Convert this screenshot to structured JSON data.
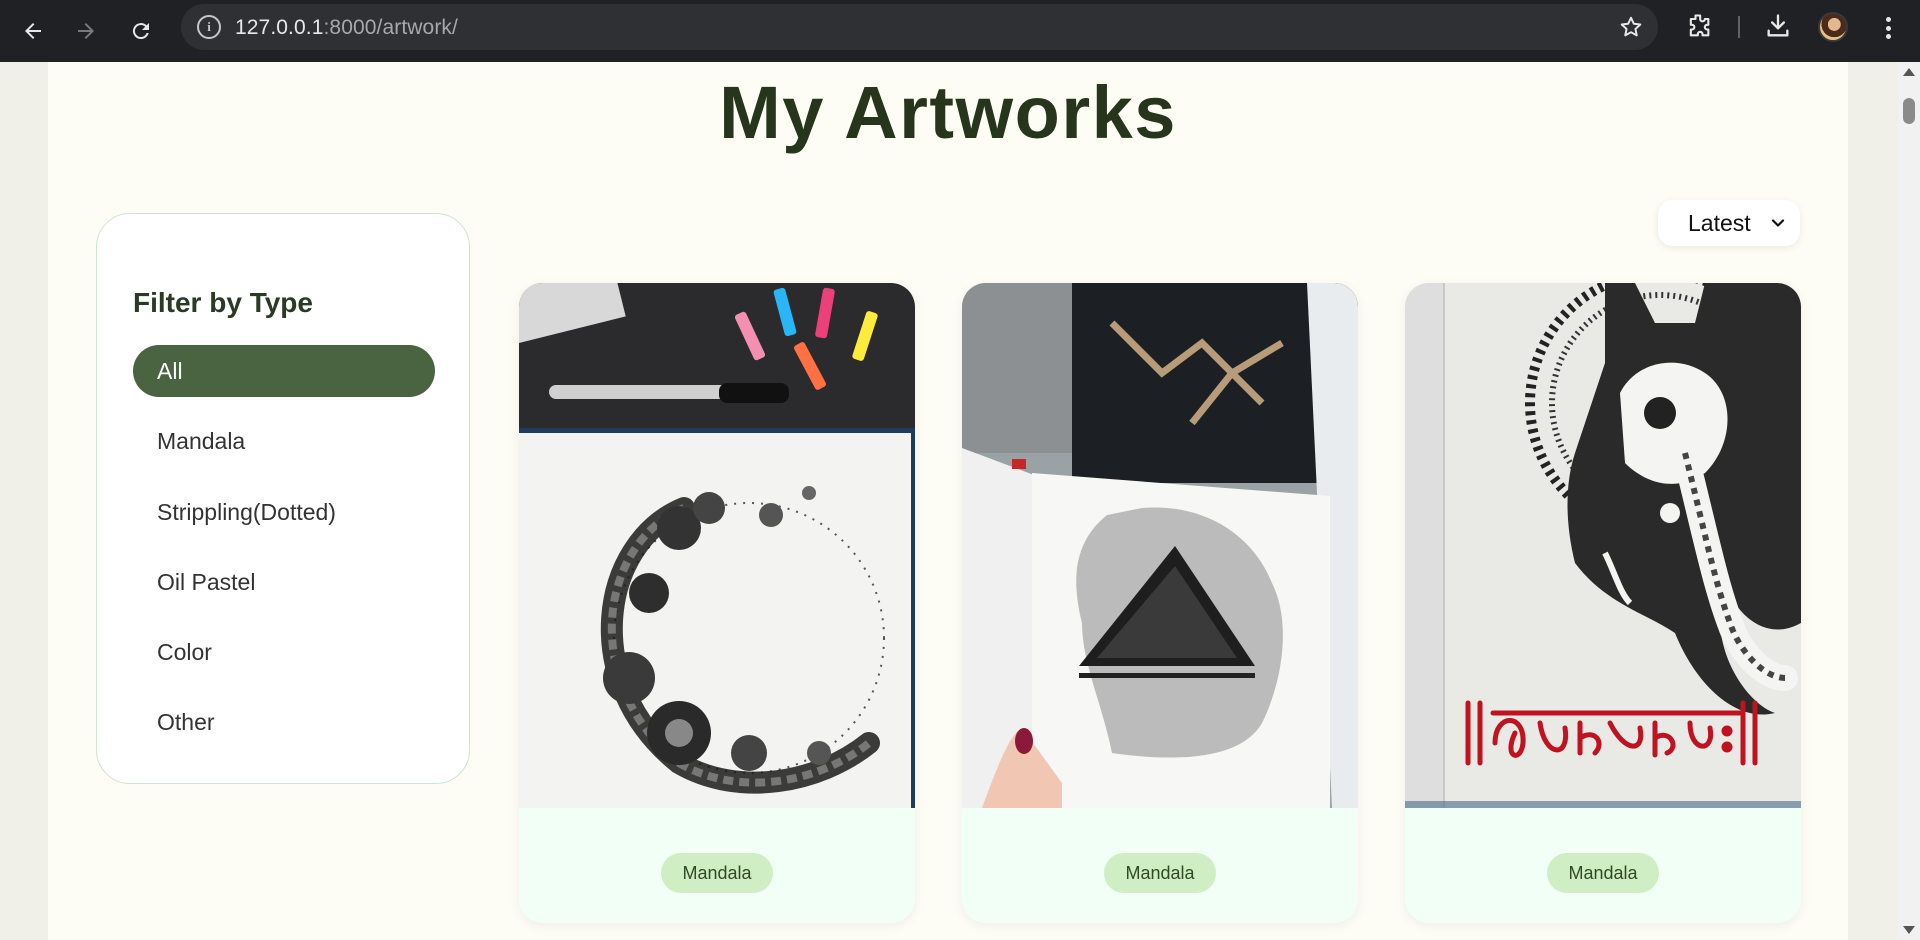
{
  "browser": {
    "url_host": "127.0.0.1",
    "url_rest": ":8000/artwork/",
    "icons": [
      "back-icon",
      "forward-icon",
      "reload-icon",
      "site-info-icon",
      "bookmark-star-icon",
      "extensions-icon",
      "download-icon",
      "profile-avatar",
      "menu-icon"
    ]
  },
  "page": {
    "title": "My Artworks",
    "sort": {
      "selected": "Latest"
    }
  },
  "filter": {
    "title": "Filter by Type",
    "items": [
      {
        "label": "All",
        "active": true
      },
      {
        "label": "Mandala"
      },
      {
        "label": "Strippling(Dotted)"
      },
      {
        "label": "Oil Pastel"
      },
      {
        "label": "Color"
      },
      {
        "label": "Other"
      }
    ]
  },
  "artworks": [
    {
      "tag": "Mandala"
    },
    {
      "tag": "Mandala"
    },
    {
      "tag": "Mandala"
    }
  ],
  "colors": {
    "accent": "#4a6340",
    "title": "#26351c",
    "tag_bg": "#cfeec4",
    "card_bg": "#f2fff6",
    "page_bg": "#fdfdf5"
  }
}
